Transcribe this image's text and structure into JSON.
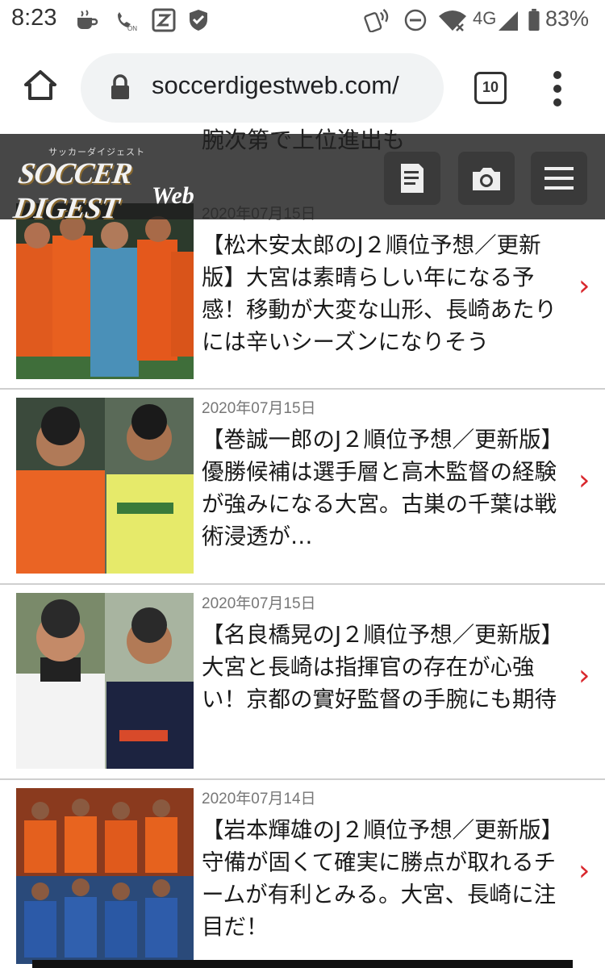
{
  "status_bar": {
    "time": "8:23",
    "network": "4G",
    "battery": "83%",
    "icons": [
      "coffee-icon",
      "call-on-icon",
      "z-app-icon",
      "shield-icon",
      "nfc-icon",
      "do-not-disturb-icon",
      "wifi-icon",
      "signal-icon",
      "battery-icon"
    ]
  },
  "browser": {
    "url": "soccerdigestweb.com/",
    "tab_count": "10"
  },
  "site": {
    "logo_katakana": "サッカーダイジェスト",
    "logo_main": "SOCCER DIGEST",
    "logo_web": "Web"
  },
  "peek_text": "腕次第で上位進出も",
  "articles": [
    {
      "date": "2020年07月15日",
      "headline": "【松木安太郎のJ２順位予想／更新版】大宮は素晴らしい年になる予感！移動が大変な山形、長崎あたりには辛いシーズンになりそう"
    },
    {
      "date": "2020年07月15日",
      "headline": "【巻誠一郎のJ２順位予想／更新版】優勝候補は選手層と高木監督の経験が強みになる大宮。古巣の千葉は戦術浸透が…"
    },
    {
      "date": "2020年07月15日",
      "headline": "【名良橋晃のJ２順位予想／更新版】大宮と長崎は指揮官の存在が心強い！京都の實好監督の手腕にも期待"
    },
    {
      "date": "2020年07月14日",
      "headline": "【岩本輝雄のJ２順位予想／更新版】守備が固くて確実に勝点が取れるチームが有利とみる。大宮、長崎に注目だ！"
    }
  ],
  "chevron": "›",
  "colors": {
    "accent": "#d8262c",
    "header_bg": "#1e1e1e",
    "omnibox_bg": "#f1f3f4"
  }
}
